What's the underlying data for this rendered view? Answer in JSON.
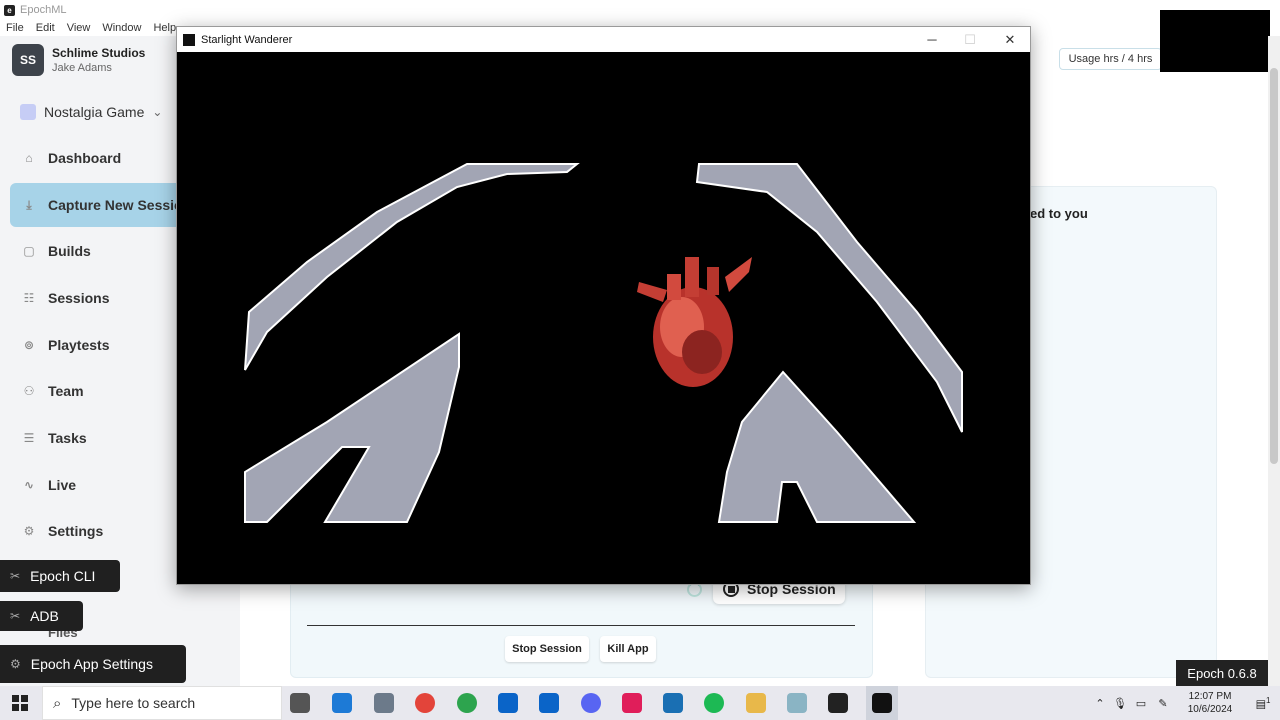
{
  "app": {
    "title": "EpochML",
    "logo_glyph": "e",
    "menu": [
      "File",
      "Edit",
      "View",
      "Window",
      "Help"
    ]
  },
  "org": {
    "initials": "SS",
    "name": "Schlime Studios",
    "user": "Jake Adams"
  },
  "project": {
    "name": "Nostalgia Game",
    "caret": "⌄"
  },
  "nav": [
    {
      "label": "Dashboard",
      "icon": "home-icon",
      "glyph": "⌂"
    },
    {
      "label": "Capture New Session",
      "icon": "capture-icon",
      "glyph": "⤓"
    },
    {
      "label": "Builds",
      "icon": "box-icon",
      "glyph": "▢"
    },
    {
      "label": "Sessions",
      "icon": "sessions-icon",
      "glyph": "☷"
    },
    {
      "label": "Playtests",
      "icon": "gamepad-icon",
      "glyph": "⊚"
    },
    {
      "label": "Team",
      "icon": "team-icon",
      "glyph": "⚇"
    },
    {
      "label": "Tasks",
      "icon": "tasks-icon",
      "glyph": "☰"
    },
    {
      "label": "Live",
      "icon": "pulse-icon",
      "glyph": "∿"
    },
    {
      "label": "Settings",
      "icon": "gear-icon",
      "glyph": "⚙"
    }
  ],
  "floating": {
    "cli": "Epoch CLI",
    "adb": "ADB",
    "files": "Files",
    "app_settings": "Epoch App Settings"
  },
  "main": {
    "usage": "Usage hrs / 4 hrs",
    "assigned_fragment": "ed to you",
    "stop_session_big": "Stop Session",
    "stop_session": "Stop Session",
    "kill_app": "Kill App",
    "version": "Epoch 0.6.8"
  },
  "game_window": {
    "title": "Starlight Wanderer",
    "minimize": "─",
    "maximize": "☐",
    "close": "✕"
  },
  "taskbar": {
    "search_placeholder": "Type here to search",
    "time": "12:07 PM",
    "date": "10/6/2024",
    "notifications": "1"
  },
  "colors": {
    "sidebar_bg": "#f3f4f6",
    "active_nav": "#a7d3e8",
    "rock": "#a2a5b4",
    "heart": "#c0392b"
  }
}
